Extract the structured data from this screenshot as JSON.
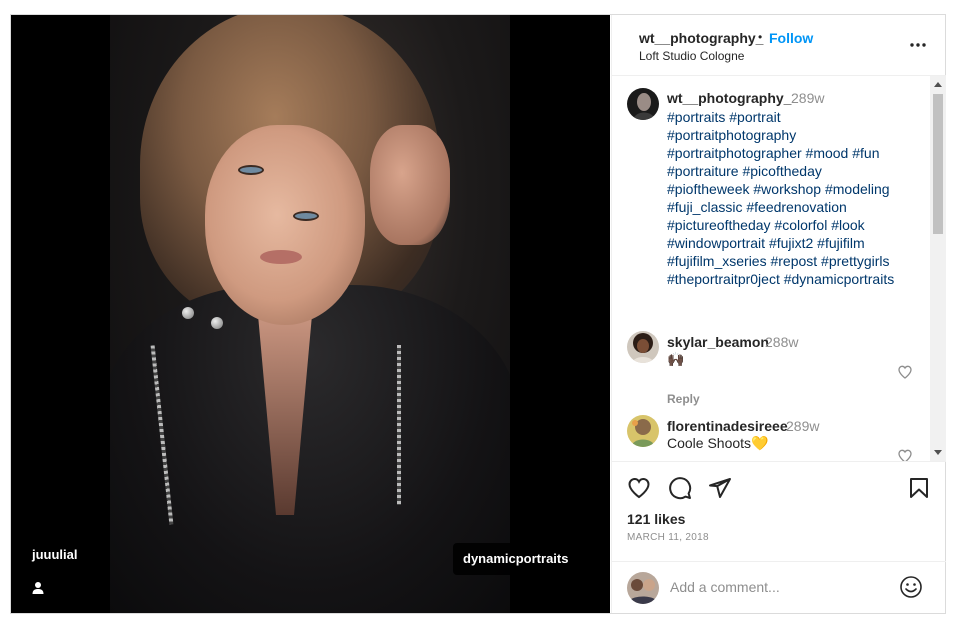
{
  "media": {
    "tag_left": "juuulial",
    "tag_right": "dynamicportraits"
  },
  "header": {
    "username": "wt__photography_",
    "separator": "•",
    "follow_label": "Follow",
    "location": "Loft Studio Cologne",
    "more_icon": "more-horizontal-icon"
  },
  "caption": {
    "username": "wt__photography_",
    "time": "289w",
    "lines": [
      "#portraits #portrait",
      "#portraitphotography",
      "#portraitphotographer #mood #fun",
      "#portraiture #picoftheday",
      "#pioftheweek #workshop #modeling",
      "#fuji_classic #feedrenovation",
      "#pictureoftheday #colorfol #look",
      "#windowportrait #fujixt2 #fujifilm",
      "#fujifilm_xseries #repost #prettygirls",
      "#theportraitpr0ject #dynamicportraits"
    ]
  },
  "comments": [
    {
      "username": "skylar_beamon",
      "time": "288w",
      "text": "🙌🏿",
      "reply_label": "Reply"
    },
    {
      "username": "florentinadesireee",
      "time": "289w",
      "text": "Coole Shoots💛"
    }
  ],
  "actions": {
    "likes": "121 likes",
    "date": "MARCH 11, 2018"
  },
  "add_comment": {
    "placeholder": "Add a comment..."
  },
  "colors": {
    "link": "#00376b",
    "follow": "#0095f6",
    "muted": "#8e8e8e"
  }
}
